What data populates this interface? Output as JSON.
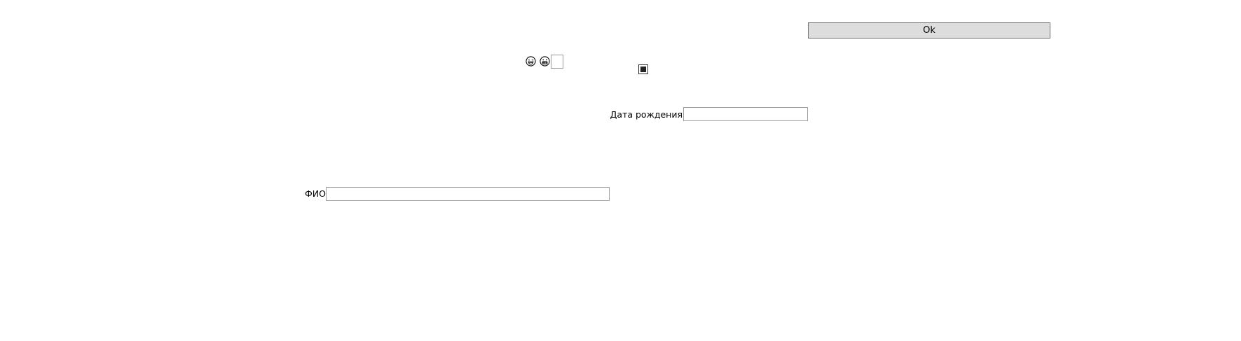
{
  "toolbar": {
    "ok_label": "Ok"
  },
  "icons": {
    "emoji_1": "laughing-face-icon",
    "emoji_2": "grinning-face-icon"
  },
  "form": {
    "birth_date": {
      "label": "Дата рождения",
      "value": ""
    },
    "full_name": {
      "label": "ФИО",
      "value": ""
    },
    "small_field_value": ""
  },
  "checkbox": {
    "checked": "indeterminate"
  }
}
